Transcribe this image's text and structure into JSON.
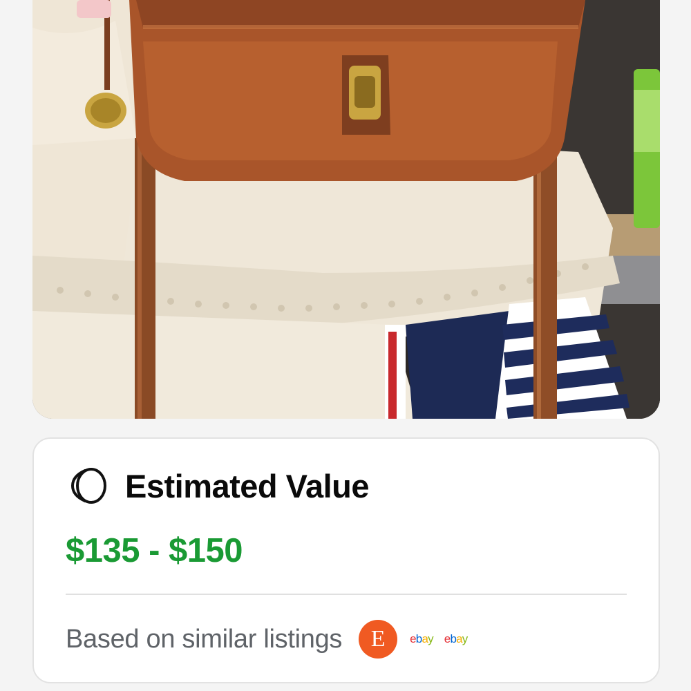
{
  "photo": {
    "subject": "brown leather crossbody bag with brass turn-lock hanging over cream lace garments"
  },
  "card": {
    "title": "Estimated Value",
    "icon": "coin-stack-icon",
    "price_range": "$135 - $150",
    "price_color": "#1a9a34",
    "source_text": "Based on similar listings",
    "sources": [
      {
        "name": "Etsy",
        "glyph": "E",
        "color": "#f05a22"
      },
      {
        "name": "ebay",
        "letters": [
          "e",
          "b",
          "a",
          "y"
        ],
        "colors": [
          "#e53238",
          "#0064d2",
          "#f5af02",
          "#86b817"
        ]
      },
      {
        "name": "ebay",
        "letters": [
          "e",
          "b",
          "a",
          "y"
        ],
        "colors": [
          "#e53238",
          "#0064d2",
          "#f5af02",
          "#86b817"
        ]
      }
    ]
  }
}
